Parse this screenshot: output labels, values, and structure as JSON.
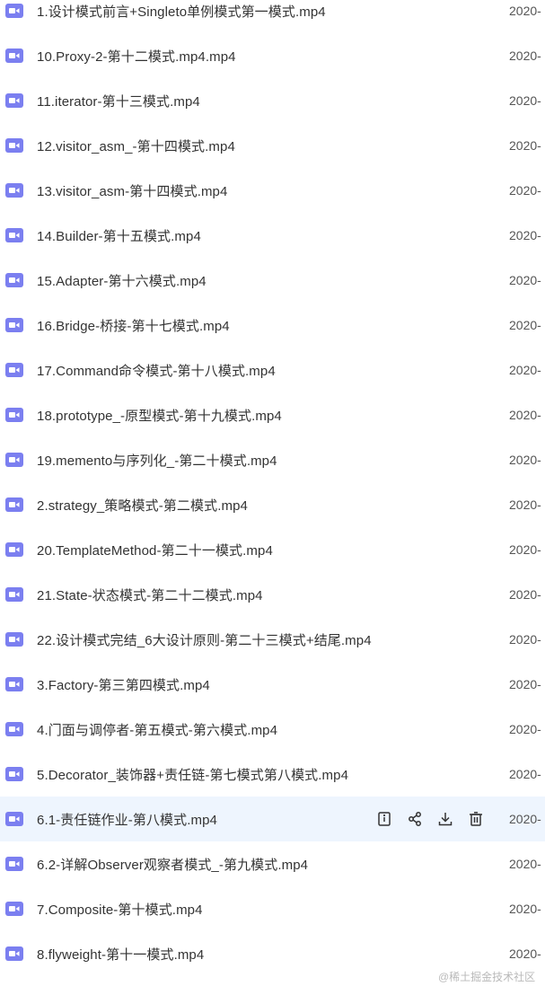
{
  "files": [
    {
      "name": "1.设计模式前言+Singleto单例模式第一模式.mp4",
      "date": "2020-"
    },
    {
      "name": "10.Proxy-2-第十二模式.mp4.mp4",
      "date": "2020-"
    },
    {
      "name": "11.iterator-第十三模式.mp4",
      "date": "2020-"
    },
    {
      "name": "12.visitor_asm_-第十四模式.mp4",
      "date": "2020-"
    },
    {
      "name": "13.visitor_asm-第十四模式.mp4",
      "date": "2020-"
    },
    {
      "name": "14.Builder-第十五模式.mp4",
      "date": "2020-"
    },
    {
      "name": "15.Adapter-第十六模式.mp4",
      "date": "2020-"
    },
    {
      "name": "16.Bridge-桥接-第十七模式.mp4",
      "date": "2020-"
    },
    {
      "name": "17.Command命令模式-第十八模式.mp4",
      "date": "2020-"
    },
    {
      "name": "18.prototype_-原型模式-第十九模式.mp4",
      "date": "2020-"
    },
    {
      "name": "19.memento与序列化_-第二十模式.mp4",
      "date": "2020-"
    },
    {
      "name": "2.strategy_策略模式-第二模式.mp4",
      "date": "2020-"
    },
    {
      "name": "20.TemplateMethod-第二十一模式.mp4",
      "date": "2020-"
    },
    {
      "name": "21.State-状态模式-第二十二模式.mp4",
      "date": "2020-"
    },
    {
      "name": "22.设计模式完结_6大设计原则-第二十三模式+结尾.mp4",
      "date": "2020-"
    },
    {
      "name": "3.Factory-第三第四模式.mp4",
      "date": "2020-"
    },
    {
      "name": "4.门面与调停者-第五模式-第六模式.mp4",
      "date": "2020-"
    },
    {
      "name": "5.Decorator_装饰器+责任链-第七模式第八模式.mp4",
      "date": "2020-"
    },
    {
      "name": "6.1-责任链作业-第八模式.mp4",
      "date": "2020-"
    },
    {
      "name": "6.2-详解Observer观察者模式_-第九模式.mp4",
      "date": "2020-"
    },
    {
      "name": "7.Composite-第十模式.mp4",
      "date": "2020-"
    },
    {
      "name": "8.flyweight-第十一模式.mp4",
      "date": "2020-"
    }
  ],
  "hovered_index": 18,
  "row_actions": [
    "details-icon",
    "share-icon",
    "download-icon",
    "delete-icon"
  ],
  "colors": {
    "video_icon": "#7b7ff0",
    "hover_background": "#eef5fe",
    "action_icon": "#333333"
  },
  "watermark": "@稀土掘金技术社区"
}
